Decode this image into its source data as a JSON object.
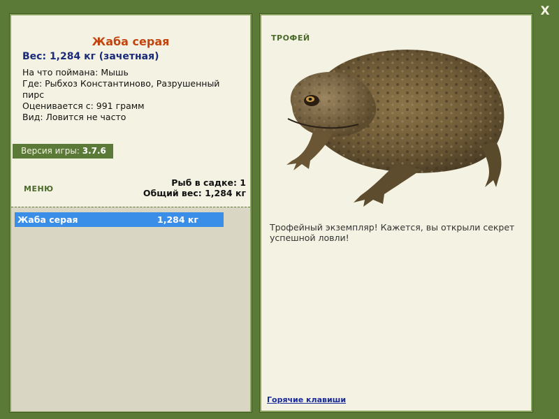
{
  "window": {
    "close_label": "X"
  },
  "fish_info": {
    "title": "Жаба серая",
    "weight_line": "Вес: 1,284 кг (зачетная)",
    "caught_on": "На что поймана: Мышь",
    "location": "Где: Рыбхоз Константиново, Разрушенный пирс",
    "valued_from": "Оценивается с: 991 грамм",
    "kind": "Вид: Ловится не часто"
  },
  "version": {
    "label": "Версия игры:",
    "value": "3.7.6"
  },
  "menu": {
    "label": "МЕНЮ"
  },
  "keepnet": {
    "count_line": "Рыб в садке: 1",
    "total_line": "Общий вес: 1,284 кг",
    "fish": [
      {
        "name": "Жаба серая",
        "weight": "1,284 кг",
        "selected": true
      }
    ]
  },
  "trophy": {
    "label": "ТРОФЕЙ",
    "image_icon": "toad-image",
    "description": "Трофейный экземпляр! Кажется, вы открыли секрет успешной ловли!"
  },
  "footer": {
    "hotkeys_label": "Горячие клавиши"
  },
  "colors": {
    "frame": "#5b7a38",
    "panel": "#f4f2e2",
    "title": "#c2440e",
    "weight": "#1a2a7a",
    "selection": "#3a8ee8"
  }
}
